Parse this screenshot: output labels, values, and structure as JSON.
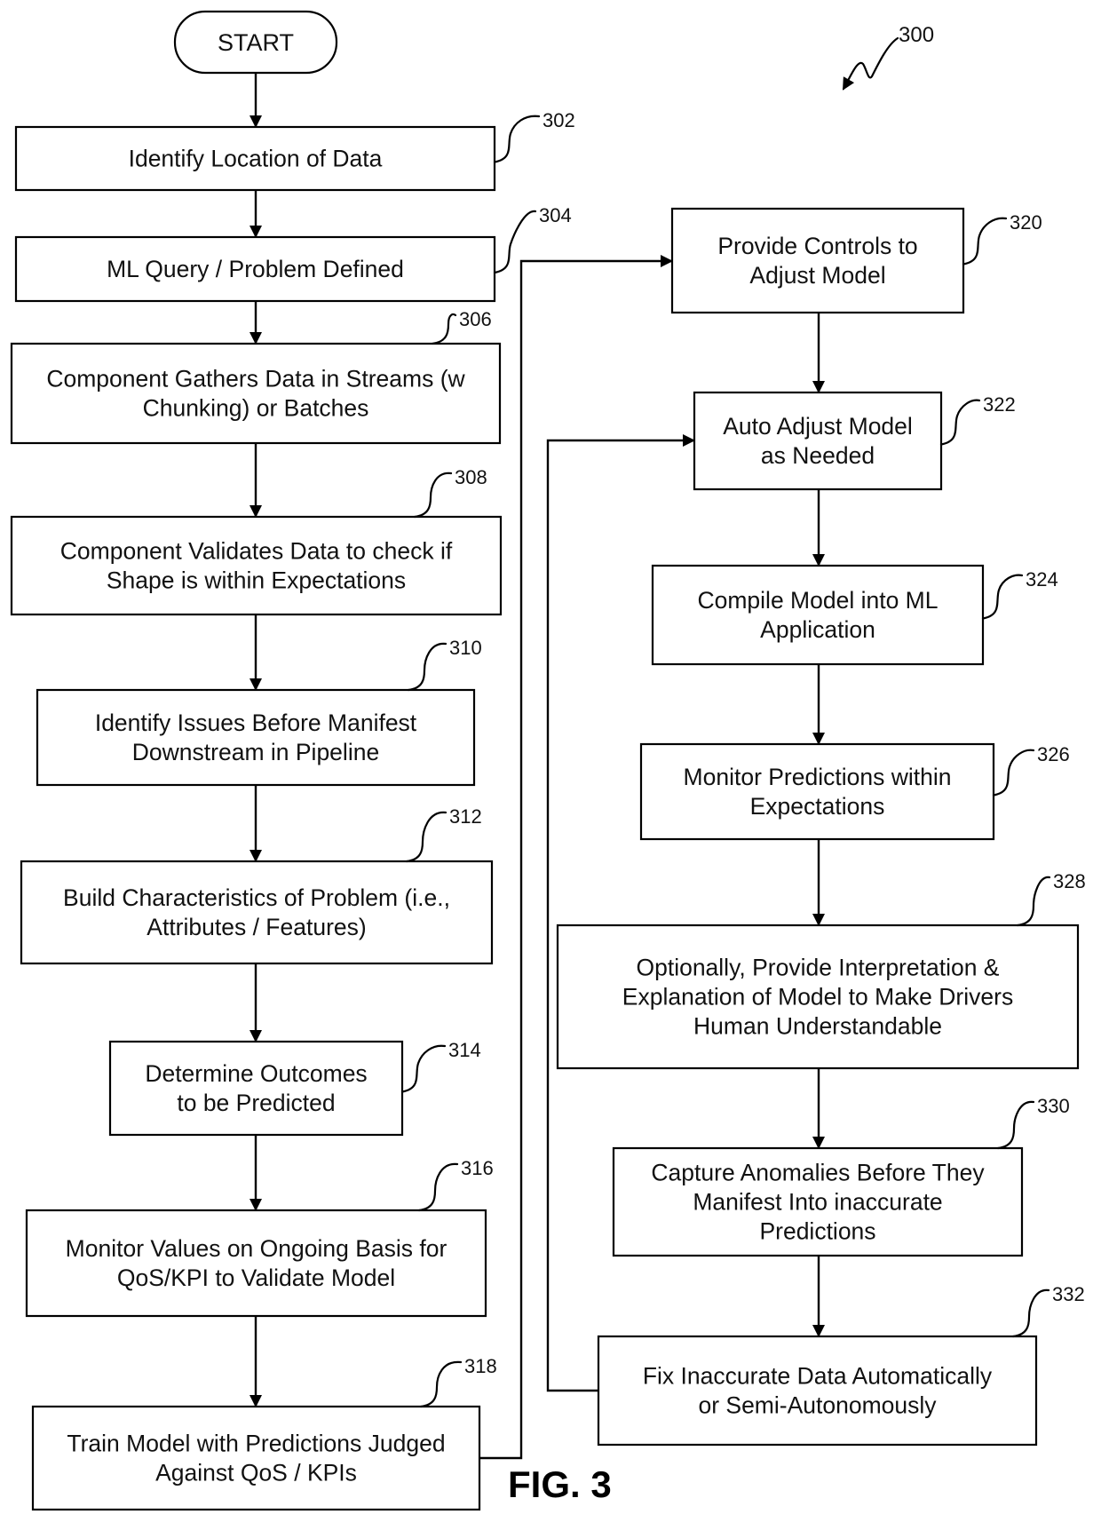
{
  "figure": {
    "ref_number": "300",
    "caption": "FIG. 3"
  },
  "start": {
    "label": "START"
  },
  "steps": [
    {
      "ref": "302",
      "lines": [
        "Identify Location of Data"
      ]
    },
    {
      "ref": "304",
      "lines": [
        "ML Query / Problem Defined"
      ]
    },
    {
      "ref": "306",
      "lines": [
        "Component Gathers Data in Streams (w",
        "Chunking) or Batches"
      ]
    },
    {
      "ref": "308",
      "lines": [
        "Component Validates Data to check if",
        "Shape is within Expectations"
      ]
    },
    {
      "ref": "310",
      "lines": [
        "Identify Issues Before Manifest",
        "Downstream in Pipeline"
      ]
    },
    {
      "ref": "312",
      "lines": [
        "Build Characteristics of Problem (i.e.,",
        "Attributes / Features)"
      ]
    },
    {
      "ref": "314",
      "lines": [
        "Determine Outcomes",
        "to be Predicted"
      ]
    },
    {
      "ref": "316",
      "lines": [
        "Monitor Values on Ongoing Basis for",
        "QoS/KPI to Validate Model"
      ]
    },
    {
      "ref": "318",
      "lines": [
        "Train Model with Predictions Judged",
        "Against QoS / KPIs"
      ]
    },
    {
      "ref": "320",
      "lines": [
        "Provide Controls to",
        "Adjust Model"
      ]
    },
    {
      "ref": "322",
      "lines": [
        "Auto Adjust Model",
        "as Needed"
      ]
    },
    {
      "ref": "324",
      "lines": [
        "Compile Model into ML",
        "Application"
      ]
    },
    {
      "ref": "326",
      "lines": [
        "Monitor Predictions within",
        "Expectations"
      ]
    },
    {
      "ref": "328",
      "lines": [
        "Optionally, Provide Interpretation &",
        "Explanation of Model to Make Drivers",
        "Human Understandable"
      ]
    },
    {
      "ref": "330",
      "lines": [
        "Capture Anomalies Before They",
        "Manifest Into inaccurate",
        "Predictions"
      ]
    },
    {
      "ref": "332",
      "lines": [
        "Fix Inaccurate Data Automatically",
        "or Semi-Autonomously"
      ]
    }
  ],
  "flow": [
    [
      "start",
      "302"
    ],
    [
      "302",
      "304"
    ],
    [
      "304",
      "306"
    ],
    [
      "306",
      "308"
    ],
    [
      "308",
      "310"
    ],
    [
      "310",
      "312"
    ],
    [
      "312",
      "314"
    ],
    [
      "314",
      "316"
    ],
    [
      "316",
      "318"
    ],
    [
      "318",
      "320"
    ],
    [
      "320",
      "322"
    ],
    [
      "322",
      "324"
    ],
    [
      "324",
      "326"
    ],
    [
      "326",
      "328"
    ],
    [
      "328",
      "330"
    ],
    [
      "330",
      "332"
    ],
    [
      "332",
      "322"
    ]
  ]
}
